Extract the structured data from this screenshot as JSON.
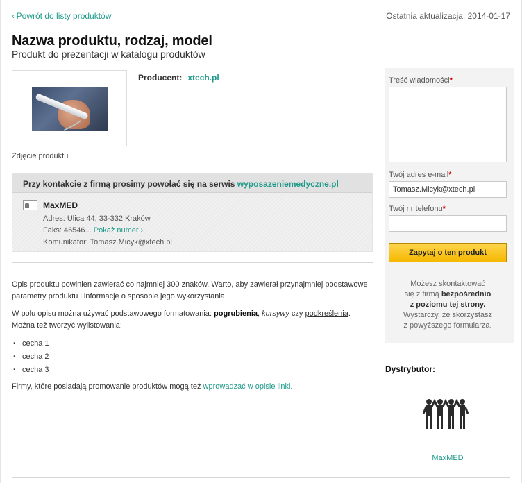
{
  "header": {
    "back_link": "Powrót do listy produktów",
    "last_update_label": "Ostatnia aktualizacja:",
    "last_update_date": "2014-01-17"
  },
  "product": {
    "title": "Nazwa produktu, rodzaj, model",
    "subtitle": "Produkt do prezentacji w katalogu produktów",
    "photo_caption": "Zdjęcie produktu",
    "producer_label": "Producent:",
    "producer_value": "xtech.pl"
  },
  "contact": {
    "notice_prefix": "Przy kontakcie z firmą prosimy powołać się na serwis ",
    "notice_site": "wyposazeniemedyczne.pl",
    "company": "MaxMED",
    "address": "Adres: Ulica 44, 33-332 Kraków",
    "fax": "Faks: 46546...",
    "show_number": "Pokaż numer",
    "messenger": "Komunikator: Tomasz.Micyk@xtech.pl"
  },
  "description": {
    "p1": "Opis produktu powinien zawierać co najmniej 300 znaków. Warto, aby zawierał przynajmniej podstawowe parametry produktu i informację o sposobie jego wykorzystania.",
    "p2_a": "W polu opisu można używać podstawowego formatowania: ",
    "p2_bold": "pogrubienia",
    "p2_b": ", ",
    "p2_italic": "kursywy",
    "p2_c": " czy ",
    "p2_underline": "podkreślenia",
    "p2_d": ". Można też tworzyć wylistowania:",
    "features": [
      "cecha 1",
      "cecha 2",
      "cecha 3"
    ],
    "p3_a": "Firmy, które posiadają promowanie produktów mogą też ",
    "p3_link": "wprowadzać w opisie linki",
    "p3_b": "."
  },
  "form": {
    "message_label": "Treść wiadomości",
    "email_label": "Twój adres e-mail",
    "email_value": "Tomasz.Micyk@xtech.pl",
    "phone_label": "Twój nr telefonu",
    "phone_value": "",
    "submit": "Zapytaj o ten produkt",
    "required_mark": "*"
  },
  "side_note": {
    "l1": "Możesz skontaktować",
    "l2_a": "się z firmą ",
    "l2_b": "bezpośrednio",
    "l3": "z poziomu tej strony.",
    "l4": "Wystarczy, że skorzystasz",
    "l5": "z powyższego formularza."
  },
  "distributor": {
    "label": "Dystrybutor:",
    "name": "MaxMED",
    "logo_icon": "people-group-icon"
  },
  "colors": {
    "accent": "#1e9a8a",
    "cta": "#f5b800",
    "required": "#cc0000"
  }
}
